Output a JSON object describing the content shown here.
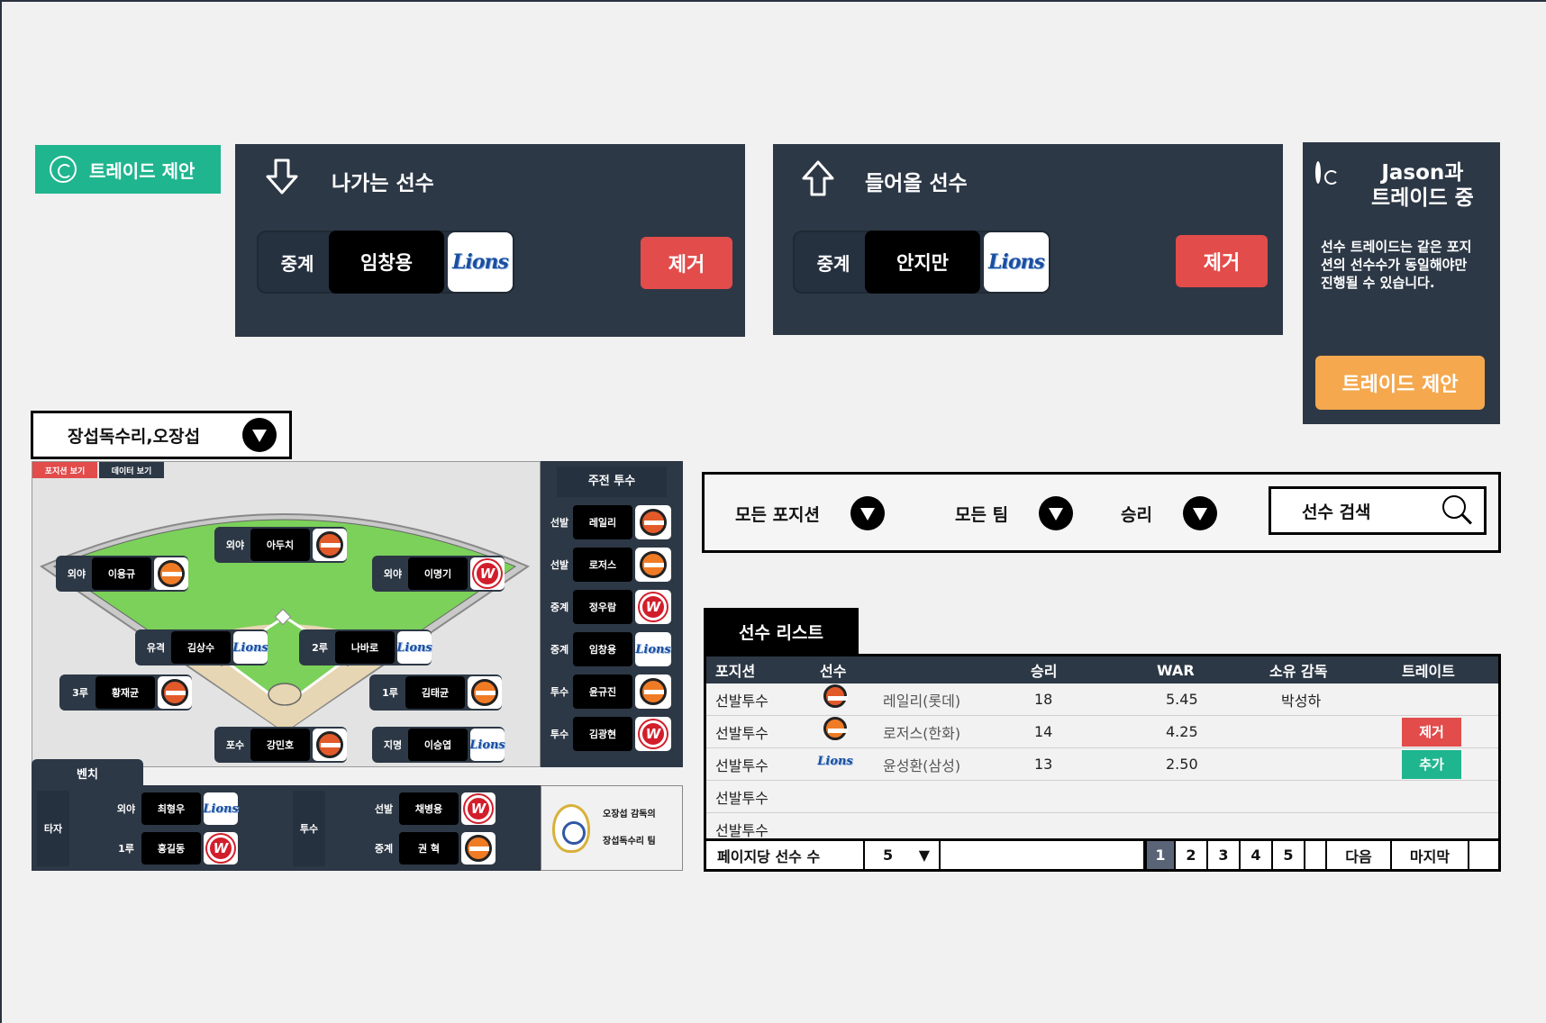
{
  "tag": {
    "label": "트레이드 제안"
  },
  "outgoing": {
    "title": "나가는 선수",
    "player": {
      "position": "중계",
      "name": "임창용",
      "team_logo": "Lions"
    },
    "remove_label": "제거"
  },
  "incoming": {
    "title": "들어올 선수",
    "player": {
      "position": "중계",
      "name": "안지만",
      "team_logo": "Lions"
    },
    "remove_label": "제거"
  },
  "trade_panel": {
    "title_line1": "Jason과",
    "title_line2": "트레이드 중",
    "desc_line1": "선수 트레이드는 같은 포지",
    "desc_line2": "션의 선수수가 동일해야만",
    "desc_line3": "진행될 수 있습니다.",
    "button": "트레이드 제안"
  },
  "team_select": {
    "value": "장섭독수리,오장섭"
  },
  "field": {
    "tabs": [
      "포지션 보기",
      "데이터 보기"
    ],
    "players": [
      {
        "pos": "외야",
        "name": "아두치",
        "logo": "giants"
      },
      {
        "pos": "외야",
        "name": "이용규",
        "logo": "eagles"
      },
      {
        "pos": "외야",
        "name": "이명기",
        "logo": "wyverns"
      },
      {
        "pos": "유격",
        "name": "김상수",
        "logo": "lions"
      },
      {
        "pos": "2루",
        "name": "나바로",
        "logo": "lions"
      },
      {
        "pos": "3루",
        "name": "황재균",
        "logo": "giants"
      },
      {
        "pos": "1루",
        "name": "김태균",
        "logo": "eagles"
      },
      {
        "pos": "포수",
        "name": "강민호",
        "logo": "giants"
      },
      {
        "pos": "지명",
        "name": "이승엽",
        "logo": "lions"
      }
    ]
  },
  "pitchers": {
    "title": "주전 투수",
    "rows": [
      {
        "pos": "선발",
        "name": "레일리",
        "logo": "giants"
      },
      {
        "pos": "선발",
        "name": "로저스",
        "logo": "eagles"
      },
      {
        "pos": "중계",
        "name": "정우람",
        "logo": "wyverns"
      },
      {
        "pos": "중계",
        "name": "임창용",
        "logo": "lions"
      },
      {
        "pos": "투수",
        "name": "윤규진",
        "logo": "eagles"
      },
      {
        "pos": "투수",
        "name": "김광현",
        "logo": "wyverns"
      }
    ]
  },
  "bench": {
    "tab": "벤치",
    "batter_label": "타자",
    "pitcher_label": "투수",
    "batters": [
      {
        "pos": "외야",
        "name": "최형우",
        "logo": "lions"
      },
      {
        "pos": "1루",
        "name": "홍길동",
        "logo": "wyverns"
      }
    ],
    "pitchers": [
      {
        "pos": "선발",
        "name": "채병용",
        "logo": "wyverns"
      },
      {
        "pos": "중계",
        "name": "권 혁",
        "logo": "eagles"
      }
    ]
  },
  "coach": {
    "line1": "오장섭 감독의",
    "line2": "장섭독수리 팀"
  },
  "filters": {
    "position": "모든 포지션",
    "team": "모든 팀",
    "sort": "승리",
    "search_placeholder": "선수 검색"
  },
  "list": {
    "tab": "선수 리스트",
    "headers": [
      "포지션",
      "선수",
      "승리",
      "WAR",
      "소유 감독",
      "트레이트"
    ],
    "rows": [
      {
        "position": "선발투수",
        "player": "레일리(롯데)",
        "logo": "giants",
        "wins": "18",
        "war": "5.45",
        "owner": "박성하",
        "action": ""
      },
      {
        "position": "선발투수",
        "player": "로저스(한화)",
        "logo": "eagles",
        "wins": "14",
        "war": "4.25",
        "owner": "",
        "action": "제거"
      },
      {
        "position": "선발투수",
        "player": "윤성환(삼성)",
        "logo": "lions",
        "wins": "13",
        "war": "2.50",
        "owner": "",
        "action": "추가"
      },
      {
        "position": "선발투수",
        "player": "",
        "logo": "",
        "wins": "",
        "war": "",
        "owner": "",
        "action": ""
      },
      {
        "position": "선발투수",
        "player": "",
        "logo": "",
        "wins": "",
        "war": "",
        "owner": "",
        "action": ""
      }
    ],
    "per_page_label": "페이지당 선수 수",
    "per_page_value": "5",
    "pages": [
      "1",
      "2",
      "3",
      "4",
      "5"
    ],
    "current_page": "1",
    "next": "다음",
    "last": "마지막"
  },
  "colors": {
    "green": "#1fb58f",
    "navy": "#2d3846",
    "red": "#e24c4b",
    "orange": "#f5a84e"
  }
}
